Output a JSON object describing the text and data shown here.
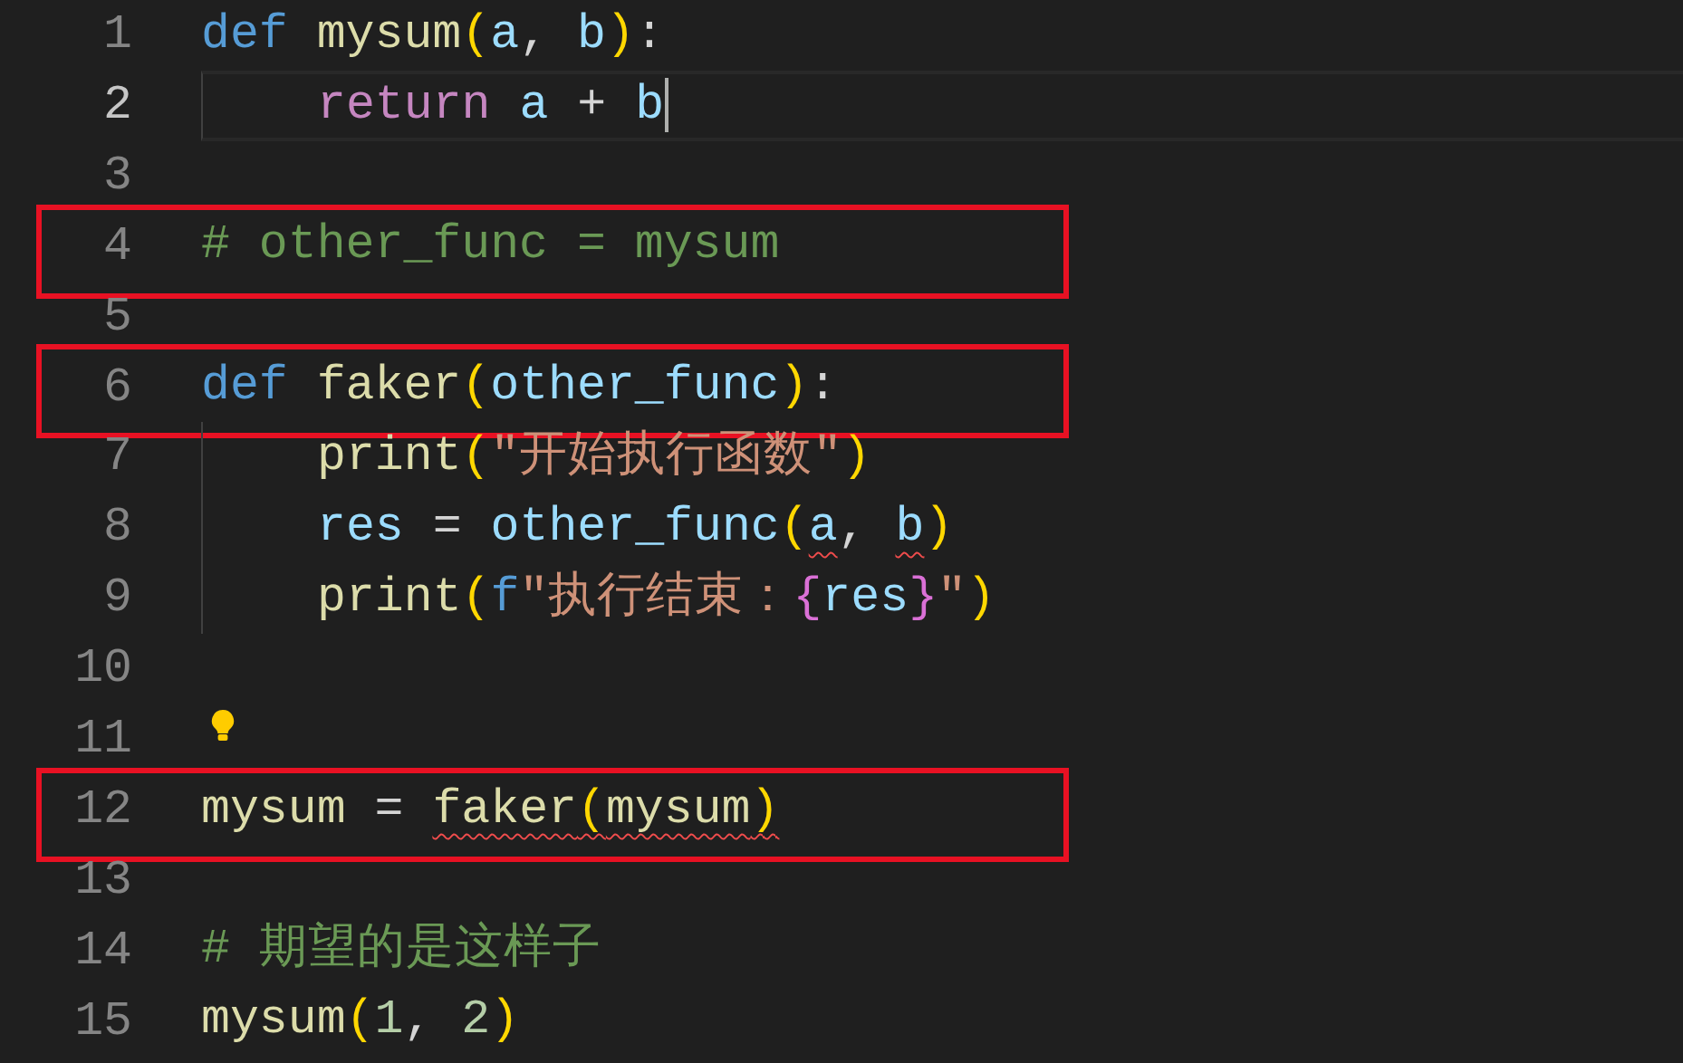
{
  "editor": {
    "lines": [
      {
        "number": "1",
        "current": false,
        "indented": false,
        "boxed": false,
        "lightbulb": false,
        "tokens": [
          {
            "text": "def ",
            "kind": "keyword",
            "squiggly": false
          },
          {
            "text": "mysum",
            "kind": "function",
            "squiggly": false
          },
          {
            "text": "(",
            "kind": "bracket",
            "squiggly": false
          },
          {
            "text": "a",
            "kind": "variable",
            "squiggly": false
          },
          {
            "text": ", ",
            "kind": "plain",
            "squiggly": false
          },
          {
            "text": "b",
            "kind": "variable",
            "squiggly": false
          },
          {
            "text": ")",
            "kind": "bracket",
            "squiggly": false
          },
          {
            "text": ":",
            "kind": "plain",
            "squiggly": false
          }
        ]
      },
      {
        "number": "2",
        "current": true,
        "indented": true,
        "boxed": false,
        "lightbulb": false,
        "tokens": [
          {
            "text": "return ",
            "kind": "control",
            "squiggly": false
          },
          {
            "text": "a",
            "kind": "variable",
            "squiggly": false
          },
          {
            "text": " + ",
            "kind": "plain",
            "squiggly": false
          },
          {
            "text": "b",
            "kind": "variable",
            "squiggly": false
          }
        ]
      },
      {
        "number": "3",
        "current": false,
        "indented": false,
        "boxed": false,
        "lightbulb": false
      },
      {
        "number": "4",
        "current": false,
        "indented": false,
        "boxed": true,
        "lightbulb": false,
        "tokens": [
          {
            "text": "# other_func = mysum",
            "kind": "comment",
            "squiggly": false
          }
        ]
      },
      {
        "number": "5",
        "current": false,
        "indented": false,
        "boxed": false,
        "lightbulb": false
      },
      {
        "number": "6",
        "current": false,
        "indented": false,
        "boxed": true,
        "lightbulb": false,
        "tokens": [
          {
            "text": "def ",
            "kind": "keyword",
            "squiggly": false
          },
          {
            "text": "faker",
            "kind": "function",
            "squiggly": false
          },
          {
            "text": "(",
            "kind": "bracket",
            "squiggly": false
          },
          {
            "text": "other_func",
            "kind": "variable",
            "squiggly": false
          },
          {
            "text": ")",
            "kind": "bracket",
            "squiggly": false
          },
          {
            "text": ":",
            "kind": "plain",
            "squiggly": false
          }
        ]
      },
      {
        "number": "7",
        "current": false,
        "indented": true,
        "boxed": false,
        "lightbulb": false,
        "tokens": [
          {
            "text": "print",
            "kind": "function",
            "squiggly": false
          },
          {
            "text": "(",
            "kind": "bracket",
            "squiggly": false
          },
          {
            "text": "\"开始执行函数\"",
            "kind": "string",
            "squiggly": false
          },
          {
            "text": ")",
            "kind": "bracket",
            "squiggly": false
          }
        ]
      },
      {
        "number": "8",
        "current": false,
        "indented": true,
        "boxed": false,
        "lightbulb": false,
        "tokens": [
          {
            "text": "res",
            "kind": "variable",
            "squiggly": false
          },
          {
            "text": " = ",
            "kind": "plain",
            "squiggly": false
          },
          {
            "text": "other_func",
            "kind": "variable",
            "squiggly": false
          },
          {
            "text": "(",
            "kind": "bracket",
            "squiggly": false
          },
          {
            "text": "a",
            "kind": "variable",
            "squiggly": true
          },
          {
            "text": ", ",
            "kind": "plain",
            "squiggly": false
          },
          {
            "text": "b",
            "kind": "variable",
            "squiggly": true
          },
          {
            "text": ")",
            "kind": "bracket",
            "squiggly": false
          }
        ]
      },
      {
        "number": "9",
        "current": false,
        "indented": true,
        "boxed": false,
        "lightbulb": false,
        "tokens": [
          {
            "text": "print",
            "kind": "function",
            "squiggly": false
          },
          {
            "text": "(",
            "kind": "bracket",
            "squiggly": false
          },
          {
            "text": "f",
            "kind": "keyword",
            "squiggly": false
          },
          {
            "text": "\"执行结束：",
            "kind": "string",
            "squiggly": false
          },
          {
            "text": "{",
            "kind": "brace",
            "squiggly": false
          },
          {
            "text": "res",
            "kind": "variable",
            "squiggly": false
          },
          {
            "text": "}",
            "kind": "brace",
            "squiggly": false
          },
          {
            "text": "\"",
            "kind": "string",
            "squiggly": false
          },
          {
            "text": ")",
            "kind": "bracket",
            "squiggly": false
          }
        ]
      },
      {
        "number": "10",
        "current": false,
        "indented": false,
        "boxed": false,
        "lightbulb": false
      },
      {
        "number": "11",
        "current": false,
        "indented": false,
        "boxed": false,
        "lightbulb": true
      },
      {
        "number": "12",
        "current": false,
        "indented": false,
        "boxed": true,
        "lightbulb": false,
        "tokens": [
          {
            "text": "mysum",
            "kind": "function",
            "squiggly": false
          },
          {
            "text": " = ",
            "kind": "plain",
            "squiggly": false
          },
          {
            "text": "faker",
            "kind": "function",
            "squiggly": true
          },
          {
            "text": "(",
            "kind": "bracket",
            "squiggly": true
          },
          {
            "text": "mysum",
            "kind": "function",
            "squiggly": true
          },
          {
            "text": ")",
            "kind": "bracket",
            "squiggly": true
          }
        ]
      },
      {
        "number": "13",
        "current": false,
        "indented": false,
        "boxed": false,
        "lightbulb": false
      },
      {
        "number": "14",
        "current": false,
        "indented": false,
        "boxed": false,
        "lightbulb": false,
        "tokens": [
          {
            "text": "# 期望的是这样子",
            "kind": "comment",
            "squiggly": false
          }
        ]
      },
      {
        "number": "15",
        "current": false,
        "indented": false,
        "boxed": false,
        "lightbulb": false,
        "tokens": [
          {
            "text": "mysum",
            "kind": "function",
            "squiggly": false
          },
          {
            "text": "(",
            "kind": "bracket",
            "squiggly": false
          },
          {
            "text": "1",
            "kind": "number",
            "squiggly": false
          },
          {
            "text": ", ",
            "kind": "plain",
            "squiggly": false
          },
          {
            "text": "2",
            "kind": "number",
            "squiggly": false
          },
          {
            "text": ")",
            "kind": "bracket",
            "squiggly": false
          }
        ]
      }
    ]
  }
}
